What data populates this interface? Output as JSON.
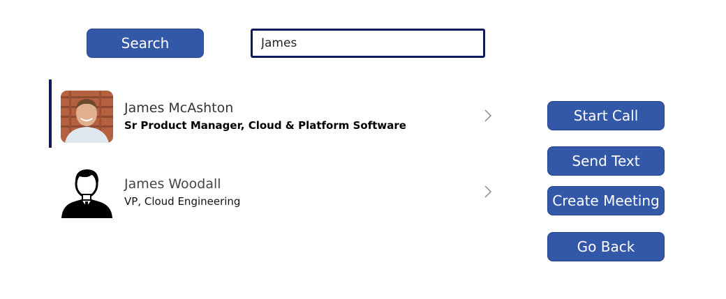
{
  "search": {
    "button_label": "Search",
    "input_value": "James"
  },
  "results": [
    {
      "name": "James McAshton",
      "title": "Sr Product Manager, Cloud & Platform Software",
      "selected": true,
      "avatar": "person-photo"
    },
    {
      "name": "James Woodall",
      "title": "VP, Cloud Engineering",
      "selected": false,
      "avatar": "person-silhouette-icon"
    }
  ],
  "actions": {
    "start_call": "Start Call",
    "send_text": "Send Text",
    "create_meeting": "Create Meeting",
    "go_back": "Go Back"
  },
  "colors": {
    "button_bg": "#3458a8",
    "accent_dark": "#0d1a5c"
  }
}
